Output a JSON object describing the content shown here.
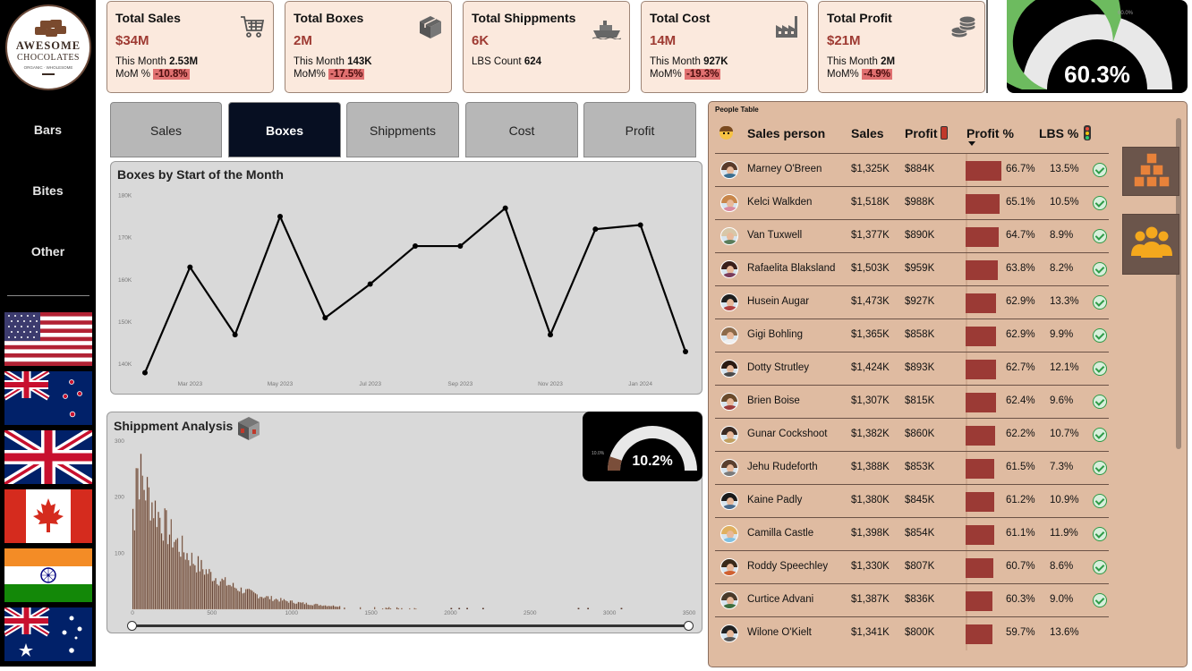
{
  "brand": {
    "line1": "AWESOME",
    "line2": "CHOCOLATES",
    "tagline": "ORGANIC · WHOLESOME"
  },
  "nav": [
    {
      "label": "Bars"
    },
    {
      "label": "Bites"
    },
    {
      "label": "Other"
    }
  ],
  "flags": [
    "usa-flag",
    "new-zealand-flag",
    "uk-flag",
    "canada-flag",
    "india-flag",
    "australia-flag"
  ],
  "kpis": [
    {
      "title": "Total Sales",
      "value": "$34M",
      "line1_label": "This Month",
      "line1_value": "2.53M",
      "line2_label": "MoM %",
      "line2_value": "-10.8%",
      "icon": "cart-icon"
    },
    {
      "title": "Total Boxes",
      "value": "2M",
      "line1_label": "This Month",
      "line1_value": "143K",
      "line2_label": "MoM%",
      "line2_value": "-17.5%",
      "icon": "box-icon"
    },
    {
      "title": "Total Shippments",
      "value": "6K",
      "line1_label": "LBS Count",
      "line1_value": "624",
      "line2_label": "",
      "line2_value": "",
      "icon": "ship-icon"
    },
    {
      "title": "Total Cost",
      "value": "14M",
      "line1_label": "This Month",
      "line1_value": "927K",
      "line2_label": "MoM%",
      "line2_value": "-19.3%",
      "icon": "factory-icon"
    },
    {
      "title": "Total Profit",
      "value": "$21M",
      "line1_label": "This Month",
      "line1_value": "2M",
      "line2_label": "MoM%",
      "line2_value": "-4.9%",
      "icon": "coins-icon"
    }
  ],
  "profit_gauge": {
    "value": "60.3%",
    "target_label": "60.0%",
    "fraction": 0.603,
    "fill": "#6dbb5f"
  },
  "tabs": [
    {
      "label": "Sales"
    },
    {
      "label": "Boxes",
      "active": true
    },
    {
      "label": "Shippments"
    },
    {
      "label": "Cost"
    },
    {
      "label": "Profit"
    }
  ],
  "line_chart": {
    "title": "Boxes by Start of the Month",
    "chart_data": {
      "type": "line",
      "x": [
        "Feb 2023",
        "Mar 2023",
        "Apr 2023",
        "May 2023",
        "Jun 2023",
        "Jul 2023",
        "Aug 2023",
        "Sep 2023",
        "Oct 2023",
        "Nov 2023",
        "Dec 2023",
        "Jan 2024",
        "Feb 2024"
      ],
      "values": [
        138000,
        163000,
        147000,
        175000,
        151000,
        159000,
        168000,
        168000,
        177000,
        147000,
        172000,
        173000,
        143000
      ],
      "ylim": [
        136000,
        182000
      ],
      "yticks": [
        "180K",
        "170K",
        "160K",
        "150K",
        "140K"
      ],
      "ytick_values": [
        180000,
        170000,
        160000,
        150000,
        140000
      ],
      "xticks": [
        "Mar 2023",
        "May 2023",
        "Jul 2023",
        "Sep 2023",
        "Nov 2023",
        "Jan 2024"
      ],
      "xtick_index": [
        1,
        3,
        5,
        7,
        9,
        11
      ],
      "grid": false,
      "color": "#000000"
    }
  },
  "shipment": {
    "title": "Shippment Analysis",
    "gauge": {
      "value": "10.2%",
      "target_label": "10.0%",
      "fraction": 0.102,
      "fill": "#7a4e3a"
    },
    "chart_data": {
      "type": "bar",
      "xlim": [
        0,
        3500
      ],
      "ylim": [
        0,
        300
      ],
      "xticks": [
        "0",
        "500",
        "1000",
        "1500",
        "2000",
        "2500",
        "3000",
        "3500"
      ],
      "xtick_values": [
        0,
        500,
        1000,
        1500,
        2000,
        2500,
        3000,
        3500
      ],
      "yticks": [
        "300",
        "200",
        "100"
      ],
      "ytick_values": [
        300,
        200,
        100
      ],
      "bin_width": 10,
      "peak": 265,
      "color": "#5a3a2e"
    }
  },
  "people": {
    "title": "People Table",
    "headers": {
      "name": "Sales person",
      "sales": "Sales",
      "profit": "Profit",
      "profit_pct": "Profit %",
      "lbs": "LBS %"
    },
    "rows": [
      {
        "name": "Marney O'Breen",
        "sales": "$1,325K",
        "profit": "$884K",
        "pct": "66.7%",
        "pv": 66.7,
        "lbs": "13.5%",
        "ok": true
      },
      {
        "name": "Kelci Walkden",
        "sales": "$1,518K",
        "profit": "$988K",
        "pct": "65.1%",
        "pv": 65.1,
        "lbs": "10.5%",
        "ok": true
      },
      {
        "name": "Van Tuxwell",
        "sales": "$1,377K",
        "profit": "$890K",
        "pct": "64.7%",
        "pv": 64.7,
        "lbs": "8.9%",
        "ok": true
      },
      {
        "name": "Rafaelita Blaksland",
        "sales": "$1,503K",
        "profit": "$959K",
        "pct": "63.8%",
        "pv": 63.8,
        "lbs": "8.2%",
        "ok": true
      },
      {
        "name": "Husein Augar",
        "sales": "$1,473K",
        "profit": "$927K",
        "pct": "62.9%",
        "pv": 62.9,
        "lbs": "13.3%",
        "ok": true
      },
      {
        "name": "Gigi Bohling",
        "sales": "$1,365K",
        "profit": "$858K",
        "pct": "62.9%",
        "pv": 62.9,
        "lbs": "9.9%",
        "ok": true
      },
      {
        "name": "Dotty Strutley",
        "sales": "$1,424K",
        "profit": "$893K",
        "pct": "62.7%",
        "pv": 62.7,
        "lbs": "12.1%",
        "ok": true
      },
      {
        "name": "Brien Boise",
        "sales": "$1,307K",
        "profit": "$815K",
        "pct": "62.4%",
        "pv": 62.4,
        "lbs": "9.6%",
        "ok": true
      },
      {
        "name": "Gunar Cockshoot",
        "sales": "$1,382K",
        "profit": "$860K",
        "pct": "62.2%",
        "pv": 62.2,
        "lbs": "10.7%",
        "ok": true
      },
      {
        "name": "Jehu Rudeforth",
        "sales": "$1,388K",
        "profit": "$853K",
        "pct": "61.5%",
        "pv": 61.5,
        "lbs": "7.3%",
        "ok": true
      },
      {
        "name": "Kaine Padly",
        "sales": "$1,380K",
        "profit": "$845K",
        "pct": "61.2%",
        "pv": 61.2,
        "lbs": "10.9%",
        "ok": true
      },
      {
        "name": "Camilla Castle",
        "sales": "$1,398K",
        "profit": "$854K",
        "pct": "61.1%",
        "pv": 61.1,
        "lbs": "11.9%",
        "ok": true
      },
      {
        "name": "Roddy Speechley",
        "sales": "$1,330K",
        "profit": "$807K",
        "pct": "60.7%",
        "pv": 60.7,
        "lbs": "8.6%",
        "ok": true
      },
      {
        "name": "Curtice Advani",
        "sales": "$1,387K",
        "profit": "$836K",
        "pct": "60.3%",
        "pv": 60.3,
        "lbs": "9.0%",
        "ok": true
      },
      {
        "name": "Wilone O'Kielt",
        "sales": "$1,341K",
        "profit": "$800K",
        "pct": "59.7%",
        "pv": 59.7,
        "lbs": "13.6%",
        "ok": false
      }
    ]
  },
  "side_buttons": [
    {
      "icon": "boxes-icon"
    },
    {
      "icon": "people-icon"
    }
  ]
}
